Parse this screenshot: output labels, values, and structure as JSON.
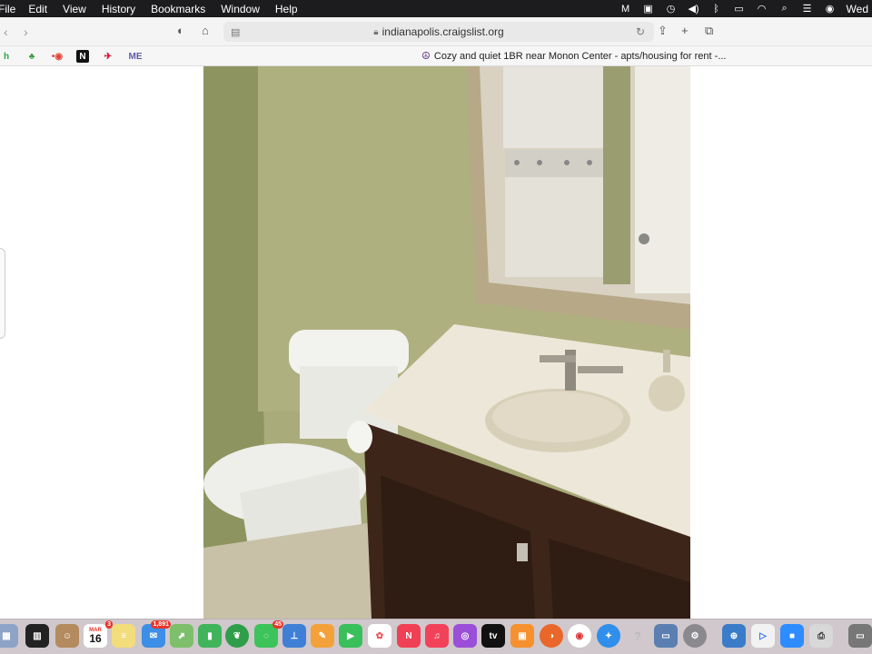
{
  "menubar": {
    "items": [
      "File",
      "Edit",
      "View",
      "History",
      "Bookmarks",
      "Window",
      "Help"
    ],
    "clock": "Wed"
  },
  "toolbar": {
    "url": "indianapolis.craigslist.org"
  },
  "favorites": {
    "items": [
      {
        "icon": "h-icon",
        "glyph": "h",
        "color": "#2aa84a"
      },
      {
        "icon": "plant-icon",
        "glyph": "♣",
        "color": "#3c9a3c"
      },
      {
        "icon": "record-icon",
        "glyph": "•◉",
        "color": "#e0453a"
      },
      {
        "icon": "notion-icon",
        "glyph": "N",
        "color": "#111111"
      },
      {
        "icon": "american-airlines-icon",
        "glyph": "✈",
        "color": "#c8102e"
      },
      {
        "icon": "me-icon",
        "glyph": "ME",
        "color": "#5b5ea6"
      }
    ]
  },
  "tab": {
    "title": "Cozy and quiet 1BR near Monon Center - apts/housing for rent -..."
  },
  "dock": {
    "calendar_month": "MAR",
    "calendar_day": "16",
    "calendar_badge": "3",
    "mail_badge": "1,891",
    "messages_badge": "45",
    "icons": [
      "launchpad-icon",
      "mission-control-icon",
      "contacts-icon",
      "calendar-icon",
      "notes-icon",
      "mail-icon",
      "maps-icon",
      "numbers-icon",
      "evernote-icon",
      "messages-icon",
      "keynote-icon",
      "pages-icon",
      "facetime-icon",
      "photos-icon",
      "news-icon",
      "music-icon",
      "podcasts-icon",
      "tv-icon",
      "books-icon",
      "firefox-icon",
      "chrome-icon",
      "safari-icon",
      "help-icon",
      "preview-icon",
      "settings-icon",
      "network-icon",
      "quicktime-icon",
      "zoom-icon",
      "printer-icon",
      "thumbnail-icon"
    ],
    "tv_label": "tv"
  },
  "colors": {
    "wall": "#a7aa76",
    "vanity": "#3a2418",
    "counter": "#e9e4d4",
    "toilet": "#f0f0ec",
    "mirror_frame": "#b9a98c"
  }
}
